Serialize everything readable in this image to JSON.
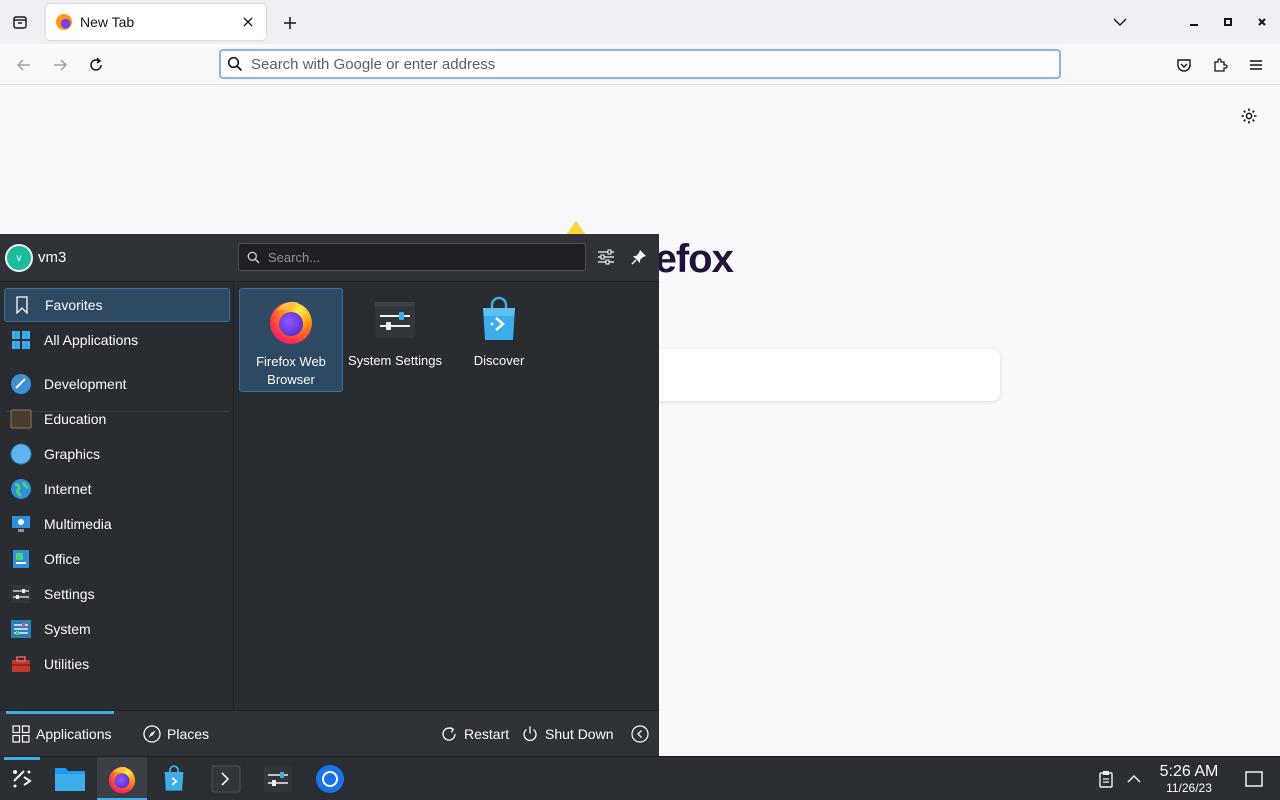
{
  "browser": {
    "tab": {
      "title": "New Tab"
    },
    "urlbar": {
      "placeholder": "Search with Google or enter address"
    },
    "page": {
      "wordmark": "refox"
    }
  },
  "launcher": {
    "user": {
      "avatar_letter": "v",
      "name": "vm3"
    },
    "search": {
      "placeholder": "Search..."
    },
    "categories": [
      {
        "label": "Favorites",
        "icon": "bookmark-icon",
        "active": true
      },
      {
        "label": "All Applications",
        "icon": "grid-icon"
      },
      {
        "label": "Development",
        "icon": "development-icon"
      },
      {
        "label": "Education",
        "icon": "education-icon"
      },
      {
        "label": "Graphics",
        "icon": "graphics-icon"
      },
      {
        "label": "Internet",
        "icon": "internet-icon"
      },
      {
        "label": "Multimedia",
        "icon": "multimedia-icon"
      },
      {
        "label": "Office",
        "icon": "office-icon"
      },
      {
        "label": "Settings",
        "icon": "settings-icon"
      },
      {
        "label": "System",
        "icon": "system-icon"
      },
      {
        "label": "Utilities",
        "icon": "utilities-icon"
      }
    ],
    "favorites": [
      {
        "label": "Firefox Web Browser",
        "icon": "firefox-icon",
        "active": true
      },
      {
        "label": "System Settings",
        "icon": "system-settings-icon"
      },
      {
        "label": "Discover",
        "icon": "discover-icon"
      }
    ],
    "footer": {
      "applications": "Applications",
      "places": "Places",
      "restart": "Restart",
      "shutdown": "Shut Down"
    }
  },
  "taskbar": {
    "clock": {
      "time": "5:26 AM",
      "date": "11/26/23"
    }
  },
  "colors": {
    "accent": "#3daee9",
    "panel": "#292c30",
    "selection": "#2e4a63"
  }
}
